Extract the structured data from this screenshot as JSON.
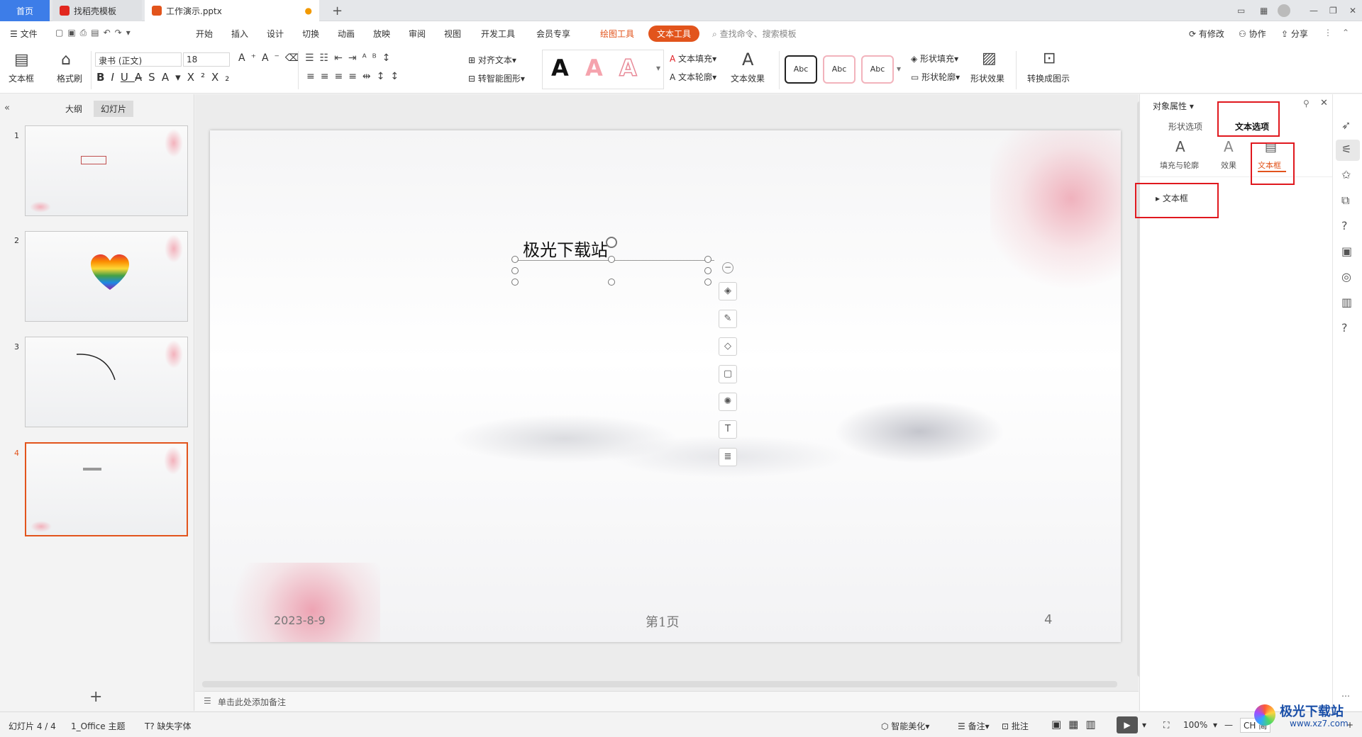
{
  "tabs": [
    {
      "label": "首页"
    },
    {
      "label": "找稻壳模板"
    },
    {
      "label": "工作演示.pptx"
    }
  ],
  "menu": {
    "file": "文件",
    "items": [
      "开始",
      "插入",
      "设计",
      "切换",
      "动画",
      "放映",
      "审阅",
      "视图",
      "开发工具",
      "会员专享"
    ],
    "drawing_tools": "绘图工具",
    "text_tools": "文本工具",
    "search_placeholder": "查找命令、搜索模板",
    "modified": "有修改",
    "collab": "协作",
    "share": "分享"
  },
  "ribbon": {
    "textbox": "文本框",
    "format_painter": "格式刷",
    "font_name": "隶书 (正文)",
    "font_size": "18",
    "align_text": "对齐文本",
    "smart_shape": "转智能图形",
    "text_fill": "文本填充",
    "text_outline": "文本轮廓",
    "text_effect": "文本效果",
    "abc": "Abc",
    "shape_fill": "形状填充",
    "shape_outline": "形状轮廓",
    "shape_effect": "形状效果",
    "convert_image": "转换成图示"
  },
  "left_panel": {
    "outline_tab": "大纲",
    "slides_tab": "幻灯片",
    "slides": [
      {
        "number": "1"
      },
      {
        "number": "2"
      },
      {
        "number": "3"
      },
      {
        "number": "4"
      }
    ]
  },
  "slide": {
    "textbox_text": "极光下载站",
    "date": "2023-8-9",
    "page_label": "第1页",
    "page_number": "4"
  },
  "notes_placeholder": "单击此处添加备注",
  "panel": {
    "title": "对象属性",
    "tab_shape": "形状选项",
    "tab_text": "文本选项",
    "sub_fill": "填充与轮廓",
    "sub_effect": "效果",
    "sub_textbox": "文本框",
    "section_textbox": "文本框"
  },
  "status": {
    "slide_counter": "幻灯片 4 / 4",
    "theme": "1_Office 主题",
    "missing_font": "缺失字体",
    "beautify": "智能美化",
    "notes": "备注",
    "comments": "批注",
    "zoom": "100%",
    "ime": "CH 简"
  },
  "watermark": {
    "text": "极光下载站",
    "url": "www.xz7.com"
  },
  "colors": {
    "accent": "#e2541c",
    "highlight_box": "#e0181e"
  }
}
